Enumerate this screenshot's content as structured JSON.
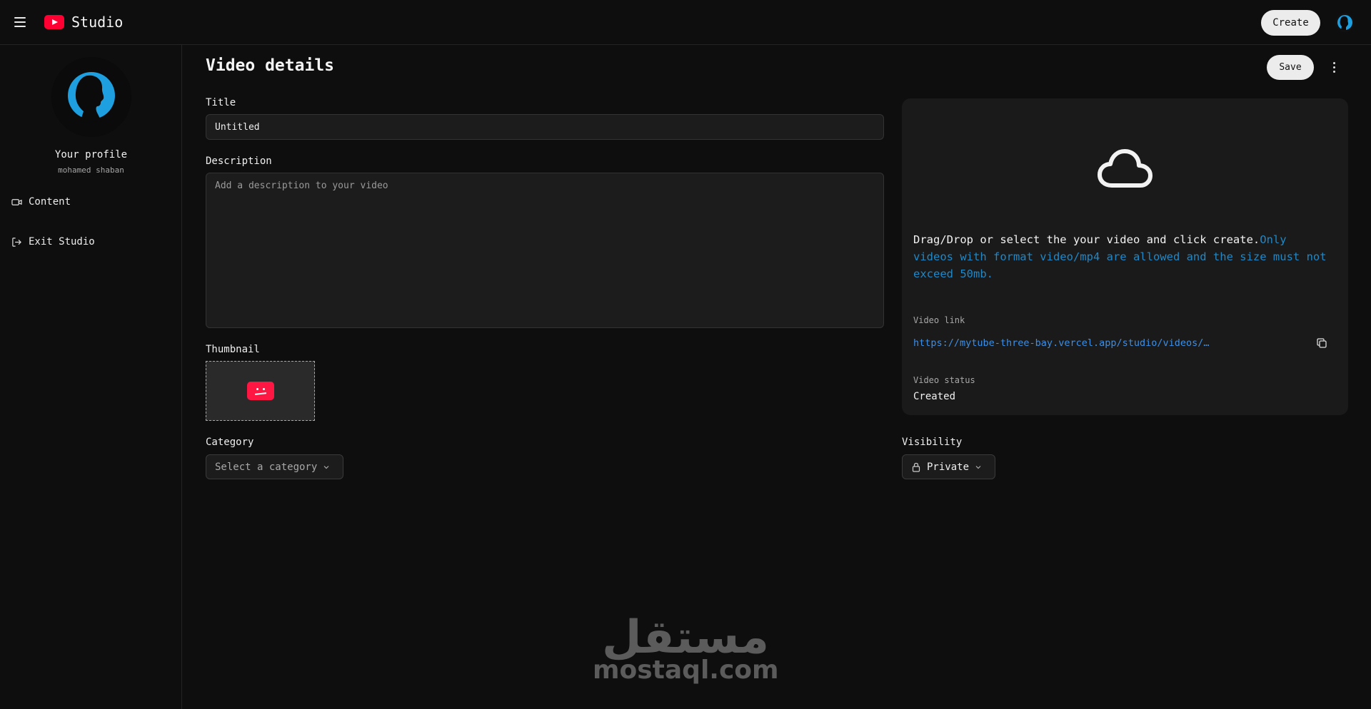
{
  "header": {
    "brand": "Studio",
    "create_label": "Create"
  },
  "sidebar": {
    "profile_title": "Your profile",
    "profile_name": "mohamed shaban",
    "items": [
      {
        "label": "Content",
        "icon": "video-camera-icon"
      },
      {
        "label": "Exit Studio",
        "icon": "log-out-icon"
      }
    ]
  },
  "main": {
    "page_title": "Video details",
    "save_label": "Save",
    "title_label": "Title",
    "title_value": "Untitled",
    "description_label": "Description",
    "description_placeholder": "Add a description to your video",
    "thumbnail_label": "Thumbnail",
    "category_label": "Category",
    "category_placeholder": "Select a category",
    "visibility_label": "Visibility",
    "visibility_value": "Private"
  },
  "upload": {
    "instruction": "Drag/Drop or select the your video and click create.",
    "hint": "Only videos with format video/mp4 are allowed and the size must not exceed 50mb.",
    "video_link_label": "Video link",
    "video_link": "https://mytube-three-bay.vercel.app/studio/videos/…",
    "video_status_label": "Video status",
    "video_status": "Created"
  },
  "watermark": {
    "arabic": "مستقل",
    "latin": "mostaql.com"
  },
  "colors": {
    "background": "#0e0e0e",
    "surface": "#1a1a1a",
    "brand_red": "#ff0033",
    "link_blue": "#3b8fe6",
    "hint_blue": "#1e88c8"
  }
}
